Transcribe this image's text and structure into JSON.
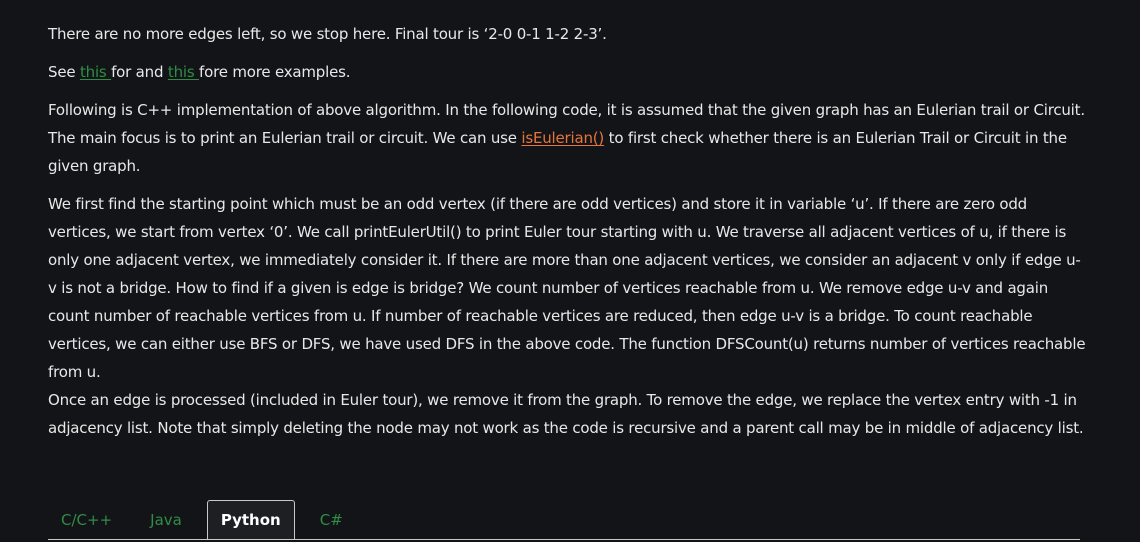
{
  "para1": "There are no more edges left, so we stop here. Final tour is ‘2-0 0-1 1-2 2-3’.",
  "para2": {
    "prefix": "See ",
    "link1": "this ",
    "middle": "for and ",
    "link2": "this ",
    "suffix": "fore more examples."
  },
  "para3": {
    "prefix": "Following is C++ implementation of above algorithm. In the following code, it is assumed that the given graph has an Eulerian trail or Circuit. The main focus is to print an Eulerian trail or circuit. We can use ",
    "link": "isEulerian()",
    "suffix": " to first check whether there is an Eulerian Trail or Circuit in the given graph."
  },
  "para4": "We first find the starting point which must be an odd vertex (if there are odd vertices) and store it in variable ‘u’. If there are zero odd vertices, we start from vertex ‘0’. We call printEulerUtil() to print Euler tour starting with u. We traverse all adjacent vertices of u, if there is only one adjacent vertex, we immediately consider it. If there are more than one adjacent vertices, we consider an adjacent v only if edge u-v is not a bridge. How to find if a given is edge is bridge? We count number of vertices reachable from u. We remove edge u-v and again count number of reachable vertices from u. If number of reachable vertices are reduced, then edge u-v is a bridge. To count reachable vertices, we can either use BFS or DFS, we have used DFS in the above code. The function DFSCount(u) returns number of vertices reachable from u.",
  "para5": "Once an edge is processed (included in Euler tour), we remove it from the graph. To remove the edge, we replace the vertex entry with -1 in adjacency list. Note that simply deleting the node may not work as the code is recursive and a parent call may be in middle of adjacency list.",
  "tabs": [
    "C/C++",
    "Java",
    "Python",
    "C#"
  ],
  "active_tab": "Python",
  "colors": {
    "background": "#131417",
    "link_green": "#2f8d46",
    "link_orange": "#e6743b"
  }
}
